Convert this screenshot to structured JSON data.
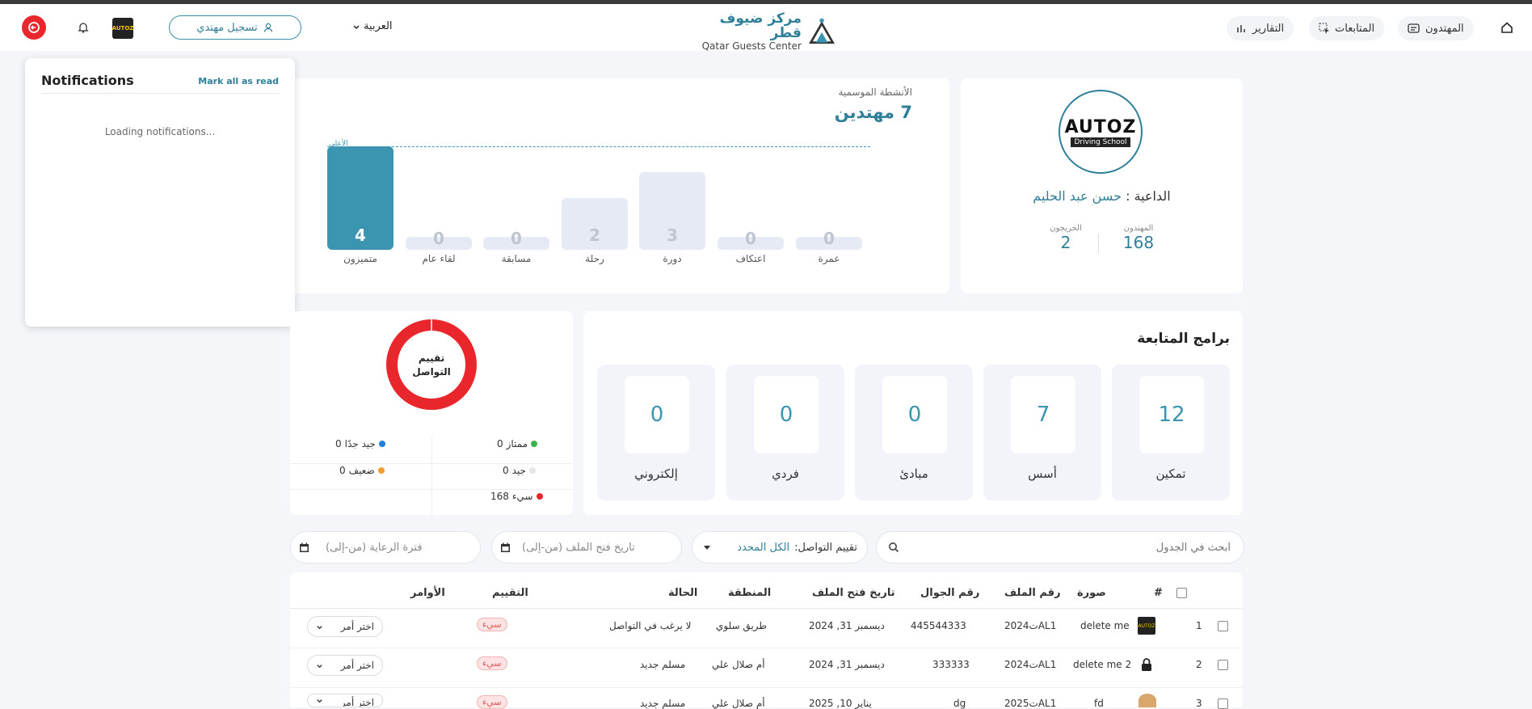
{
  "header": {
    "nav": {
      "beneficiaries": "المهتدون",
      "followups": "المتابعات",
      "reports": "التقارير"
    },
    "logo": {
      "ar": "مركز ضيوف قطر",
      "en": "Qatar Guests Center"
    },
    "language": "العربية",
    "register_label": "تسجيل مهتدي",
    "avatar_text": "AUTOZ"
  },
  "notifications": {
    "title": "Notifications",
    "mark_all": "Mark all as read",
    "loading": "Loading notifications..."
  },
  "profile": {
    "logo_text": "AUTOZ",
    "logo_sub": "Driving School",
    "preacher_label": "الداعية :",
    "preacher_name": "حسن عبد الحليم",
    "stats": [
      {
        "label": "المهتدون",
        "value": "168"
      },
      {
        "label": "الخريجون",
        "value": "2"
      }
    ]
  },
  "activities": {
    "title": "الأنشطة الموسمية",
    "count": "7 مهتدين",
    "max_label": "الأعلى",
    "bars": [
      {
        "label": "متميزون",
        "value": 4,
        "active": true
      },
      {
        "label": "لقاء عام",
        "value": 0
      },
      {
        "label": "مسابقة",
        "value": 0
      },
      {
        "label": "رحلة",
        "value": 2
      },
      {
        "label": "دورة",
        "value": 3
      },
      {
        "label": "اعتكاف",
        "value": 0
      },
      {
        "label": "عمرة",
        "value": 0
      }
    ]
  },
  "programs": {
    "title": "برامج المتابعة",
    "items": [
      {
        "label": "تمكين",
        "value": "12"
      },
      {
        "label": "أسس",
        "value": "7"
      },
      {
        "label": "مبادئ",
        "value": "0"
      },
      {
        "label": "فردي",
        "value": "0"
      },
      {
        "label": "إلكتروني",
        "value": "0"
      }
    ]
  },
  "rating": {
    "title_line1": "تقييم",
    "title_line2": "التواصل",
    "ring_color": "#e8262b",
    "legend": [
      {
        "label": "ممتاز",
        "value": "0",
        "color": "#3cb44b"
      },
      {
        "label": "جيد جدًا",
        "value": "0",
        "color": "#1e7fe0"
      },
      {
        "label": "جيد",
        "value": "0",
        "color": "#e4e6ea"
      },
      {
        "label": "ضعيف",
        "value": "0",
        "color": "#f29b30"
      },
      {
        "label": "سيء",
        "value": "168",
        "color": "#e8262b"
      }
    ]
  },
  "filters": {
    "search_placeholder": "ابحث في الجدول",
    "rating_label": "تقييم التواصل:",
    "rating_value": "الكل المحدد",
    "file_date": "تاريخ فتح الملف (من-إلى)",
    "sponsor_period": "فترة الرعاية (من-إلى)"
  },
  "table": {
    "headers": {
      "num": "#",
      "photo": "صورة",
      "file_no": "رقم الملف",
      "mobile": "رقم الجوال",
      "open_date": "تاريخ فتح الملف",
      "region": "المنطقة",
      "status": "الحالة",
      "rating": "التقييم",
      "commands": "الأوامر"
    },
    "rows": [
      {
        "num": "1",
        "name": "delete me",
        "file_no": "ت2024AL1",
        "mobile": "445544333",
        "date": "ديسمبر 31, 2024",
        "region": "طريق سلوي",
        "status": "لا يرغب في التواصل",
        "rating": "سيء",
        "cmd": "اختر أمر"
      },
      {
        "num": "2",
        "name": "delete me 2",
        "file_no": "ت2024AL1",
        "mobile": "333333",
        "date": "ديسمبر 31, 2024",
        "region": "أم صلال علي",
        "status": "مسلم جديد",
        "rating": "سيء",
        "cmd": "اختر أمر"
      },
      {
        "num": "3",
        "name": "fd",
        "file_no": "ت2025AL1",
        "mobile": "dg",
        "date": "يناير 10, 2025",
        "region": "أم صلال علي",
        "status": "مسلم جديد",
        "rating": "سيء",
        "cmd": "اختر أمر"
      }
    ]
  }
}
